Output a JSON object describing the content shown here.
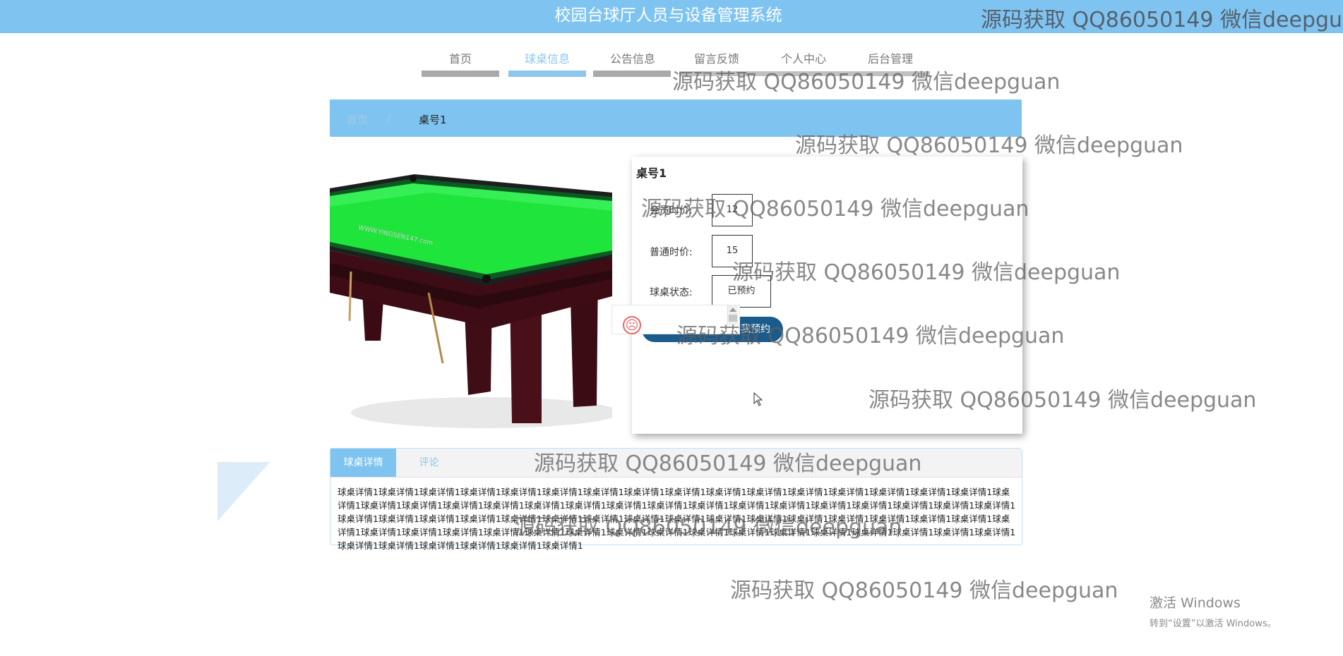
{
  "header": {
    "title": "校园台球厅人员与设备管理系统"
  },
  "nav": {
    "items": [
      {
        "label": "首页"
      },
      {
        "label": "球桌信息"
      },
      {
        "label": "公告信息"
      },
      {
        "label": "留言反馈"
      },
      {
        "label": "个人中心"
      },
      {
        "label": "后台管理"
      }
    ],
    "active_index": 1
  },
  "breadcrumb": {
    "home": "首页",
    "separator": "/",
    "current": "桌号1"
  },
  "detail": {
    "title": "桌号1",
    "fields": [
      {
        "label": "会员时价:",
        "value": "12"
      },
      {
        "label": "普通时价:",
        "value": "15"
      },
      {
        "label": "球桌状态:",
        "value": "已预约"
      }
    ],
    "reserve_button": "点我预约"
  },
  "tabs": {
    "items": [
      {
        "label": "球桌详情"
      },
      {
        "label": "评论"
      }
    ],
    "content": "球桌详情1球桌详情1球桌详情1球桌详情1球桌详情1球桌详情1球桌详情1球桌详情1球桌详情1球桌详情1球桌详情1球桌详情1球桌详情1球桌详情1球桌详情1球桌详情1球桌详情1球桌详情1球桌详情1球桌详情1球桌详情1球桌详情1球桌详情1球桌详情1球桌详情1球桌详情1球桌详情1球桌详情1球桌详情1球桌详情1球桌详情1球桌详情1球桌详情1球桌详情1球桌详情1球桌详情1球桌详情1球桌详情1球桌详情1球桌详情1球桌详情1球桌详情1球桌详情1球桌详情1球桌详情1球桌详情1球桌详情1球桌详情1球桌详情1球桌详情1球桌详情1球桌详情1球桌详情1球桌详情1球桌详情1球桌详情1球桌详情1球桌详情1球桌详情1球桌详情1球桌详情1球桌详情1球桌详情1球桌详情1球桌详情1球桌详情1球桌详情1球桌详情1球桌详情1球桌详情1球桌详情1球桌详情1"
  },
  "watermark": {
    "text": "源码获取 QQ86050149 微信deepguan"
  },
  "windows_activation": {
    "title": "激活 Windows",
    "subtitle": "转到“设置”以激活 Windows。"
  },
  "colors": {
    "brand": "#7fc4f0",
    "nav_active": "#8cc6ec",
    "button": "#1b5b8c",
    "felt": "#1fe43b"
  },
  "icons": {
    "sad": "sad-face-icon",
    "cursor": "mouse-cursor-icon"
  }
}
